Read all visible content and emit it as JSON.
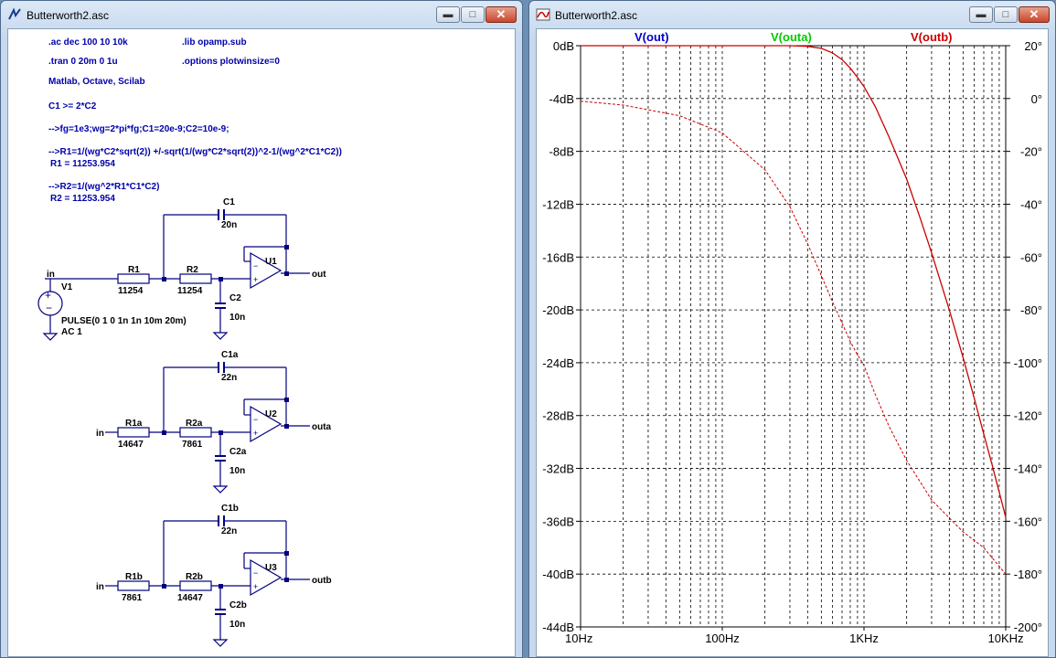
{
  "schematic_window": {
    "title": "Butterworth2.asc",
    "directives": {
      "ac": ".ac dec 100 10 10k",
      "lib": ".lib opamp.sub",
      "tran": ".tran 0 20m 0 1u",
      "options": ".options plotwinsize=0",
      "tools": "Matlab, Octave, Scilab",
      "c_cond": "C1 >= 2*C2",
      "line1": "-->fg=1e3;wg=2*pi*fg;C1=20e-9;C2=10e-9;",
      "line2": "-->R1=1/(wg*C2*sqrt(2)) +/-sqrt(1/(wg*C2*sqrt(2))^2-1/(wg^2*C1*C2))",
      "r1_result": "R1  =  11253.954",
      "line3": "-->R2=1/(wg^2*R1*C1*C2)",
      "r2_result": "R2  =  11253.954"
    },
    "circuit1": {
      "in_label": "in",
      "source": "V1",
      "source_value": "PULSE(0 1 0 1n 1n 10m 20m)",
      "source_ac": "AC 1",
      "r1": "R1",
      "r1_value": "11254",
      "r2": "R2",
      "r2_value": "11254",
      "c1": "C1",
      "c1_value": "20n",
      "c2": "C2",
      "c2_value": "10n",
      "opamp": "U1",
      "out_label": "out"
    },
    "circuit2": {
      "in_label": "in",
      "r1": "R1a",
      "r1_value": "14647",
      "r2": "R2a",
      "r2_value": "7861",
      "c1": "C1a",
      "c1_value": "22n",
      "c2": "C2a",
      "c2_value": "10n",
      "opamp": "U2",
      "out_label": "outa"
    },
    "circuit3": {
      "in_label": "in",
      "r1": "R1b",
      "r1_value": "7861",
      "r2": "R2b",
      "r2_value": "14647",
      "c1": "C1b",
      "c1_value": "22n",
      "c2": "C2b",
      "c2_value": "10n",
      "opamp": "U3",
      "out_label": "outb"
    }
  },
  "plot_window": {
    "title": "Butterworth2.asc",
    "trace_labels": [
      {
        "name": "V(out)",
        "color": "#0000cc"
      },
      {
        "name": "V(outa)",
        "color": "#00cc00"
      },
      {
        "name": "V(outb)",
        "color": "#cc0000"
      }
    ]
  },
  "window_buttons": {
    "minimize": "▬",
    "maximize": "□",
    "close": "✕"
  },
  "chart_data": {
    "type": "line",
    "x_scale": "log",
    "xlim": [
      10,
      10000
    ],
    "x_ticks": [
      "10Hz",
      "100Hz",
      "1KHz",
      "10KHz"
    ],
    "left_axis": {
      "ylim": [
        -44,
        0
      ],
      "ticks": [
        "0dB",
        "-4dB",
        "-8dB",
        "-12dB",
        "-16dB",
        "-20dB",
        "-24dB",
        "-28dB",
        "-32dB",
        "-36dB",
        "-40dB",
        "-44dB"
      ]
    },
    "right_axis": {
      "ylim": [
        -200,
        20
      ],
      "ticks": [
        "20°",
        "0°",
        "-20°",
        "-40°",
        "-60°",
        "-80°",
        "-100°",
        "-120°",
        "-140°",
        "-160°",
        "-180°",
        "-200°"
      ]
    },
    "grid": true,
    "series": [
      {
        "name": "V(outb)",
        "style": "solid",
        "color": "#cc0000",
        "axis": "left",
        "x": [
          10,
          100,
          300,
          400,
          500,
          600,
          700,
          800,
          900,
          1000,
          1200,
          1500,
          2000,
          2500,
          3000,
          4000,
          5000,
          6000,
          7000,
          8000,
          9000,
          10000
        ],
        "y": [
          0,
          0,
          0,
          -0.05,
          -0.2,
          -0.55,
          -1.05,
          -1.7,
          -2.4,
          -3.1,
          -4.6,
          -6.9,
          -10.1,
          -13.1,
          -15.7,
          -20,
          -23.6,
          -26.7,
          -29.4,
          -31.7,
          -33.8,
          -35.7
        ]
      },
      {
        "name": "V(outb) phase",
        "style": "dashed",
        "color": "#cc0000",
        "axis": "right",
        "x": [
          10,
          20,
          50,
          100,
          200,
          300,
          400,
          500,
          600,
          700,
          800,
          900,
          1000,
          1200,
          1500,
          2000,
          3000,
          5000,
          7000,
          10000
        ],
        "y": [
          -1,
          -2.5,
          -6.5,
          -13,
          -27,
          -41,
          -55,
          -67,
          -77,
          -85,
          -92,
          -97,
          -101,
          -112,
          -124,
          -137,
          -152,
          -164,
          -170,
          -180
        ]
      }
    ]
  }
}
